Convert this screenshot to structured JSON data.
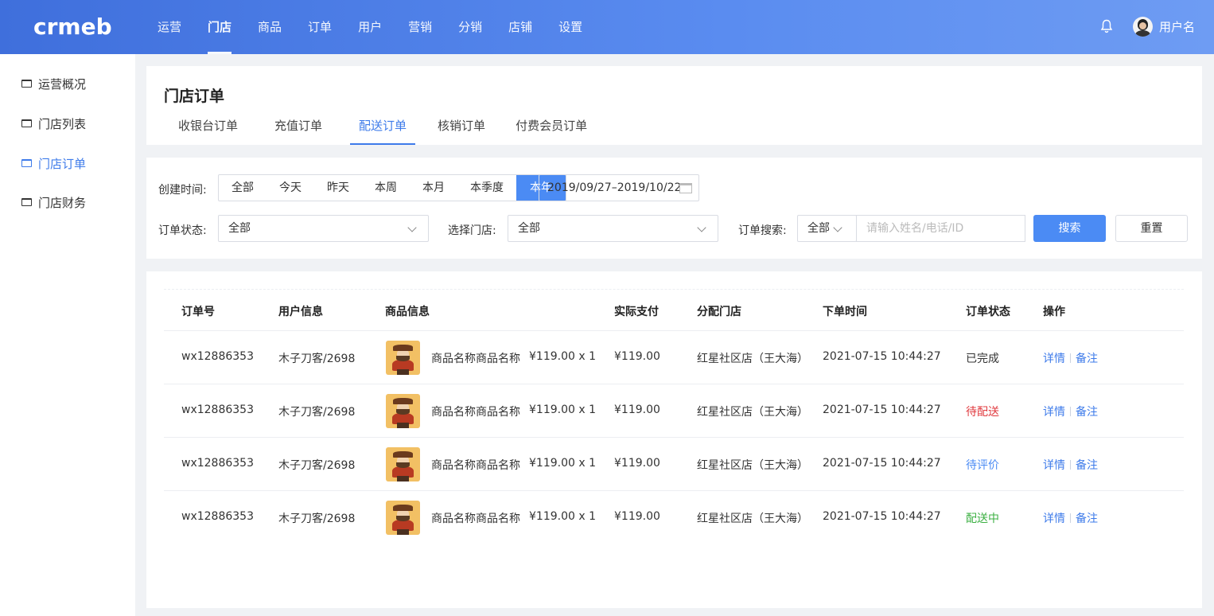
{
  "header": {
    "logo_text": "crmeb",
    "nav": [
      "运营",
      "门店",
      "商品",
      "订单",
      "用户",
      "营销",
      "分销",
      "店铺",
      "设置"
    ],
    "active_nav": "门店",
    "username": "用户名"
  },
  "sidebar": {
    "items": [
      {
        "label": "运营概况",
        "active": false
      },
      {
        "label": "门店列表",
        "active": false
      },
      {
        "label": "门店订单",
        "active": true
      },
      {
        "label": "门店财务",
        "active": false
      }
    ]
  },
  "page": {
    "title": "门店订单",
    "tabs": [
      "收银台订单",
      "充值订单",
      "配送订单",
      "核销订单",
      "付费会员订单"
    ],
    "active_tab": "配送订单"
  },
  "filters": {
    "created_time_label": "创建时间:",
    "time_options": [
      "全部",
      "今天",
      "昨天",
      "本周",
      "本月",
      "本季度",
      "本年"
    ],
    "active_time": "本年",
    "date_range": "2019/09/27–2019/10/22",
    "status_label": "订单状态:",
    "status_value": "全部",
    "store_label": "选择门店:",
    "store_value": "全部",
    "search_label": "订单搜索:",
    "search_type": "全部",
    "search_placeholder": "请输入姓名/电话/ID",
    "search_button": "搜索",
    "reset_button": "重置"
  },
  "table": {
    "columns": [
      "订单号",
      "用户信息",
      "商品信息",
      "实际支付",
      "分配门店",
      "下单时间",
      "订单状态",
      "操作"
    ],
    "rows": [
      {
        "order_no": "wx12886353",
        "user": "木子刀客/2698",
        "product": "商品名称商品名称",
        "price_qty": "¥119.00 x 1",
        "paid": "¥119.00",
        "store": "红星社区店（王大海）",
        "time": "2021-07-15 10:44:27",
        "status": "已完成",
        "status_color": "#333333",
        "op_detail": "详情",
        "op_note": "备注"
      },
      {
        "order_no": "wx12886353",
        "user": "木子刀客/2698",
        "product": "商品名称商品名称",
        "price_qty": "¥119.00 x 1",
        "paid": "¥119.00",
        "store": "红星社区店（王大海）",
        "time": "2021-07-15 10:44:27",
        "status": "待配送",
        "status_color": "#e0393e",
        "op_detail": "详情",
        "op_note": "备注"
      },
      {
        "order_no": "wx12886353",
        "user": "木子刀客/2698",
        "product": "商品名称商品名称",
        "price_qty": "¥119.00 x 1",
        "paid": "¥119.00",
        "store": "红星社区店（王大海）",
        "time": "2021-07-15 10:44:27",
        "status": "待评价",
        "status_color": "#4b8bf4",
        "op_detail": "详情",
        "op_note": "备注"
      },
      {
        "order_no": "wx12886353",
        "user": "木子刀客/2698",
        "product": "商品名称商品名称",
        "price_qty": "¥119.00 x 1",
        "paid": "¥119.00",
        "store": "红星社区店（王大海）",
        "time": "2021-07-15 10:44:27",
        "status": "配送中",
        "status_color": "#3cb043",
        "op_detail": "详情",
        "op_note": "备注"
      }
    ]
  },
  "colors": {
    "accent": "#4b8bf4",
    "link": "#3e7bea"
  }
}
